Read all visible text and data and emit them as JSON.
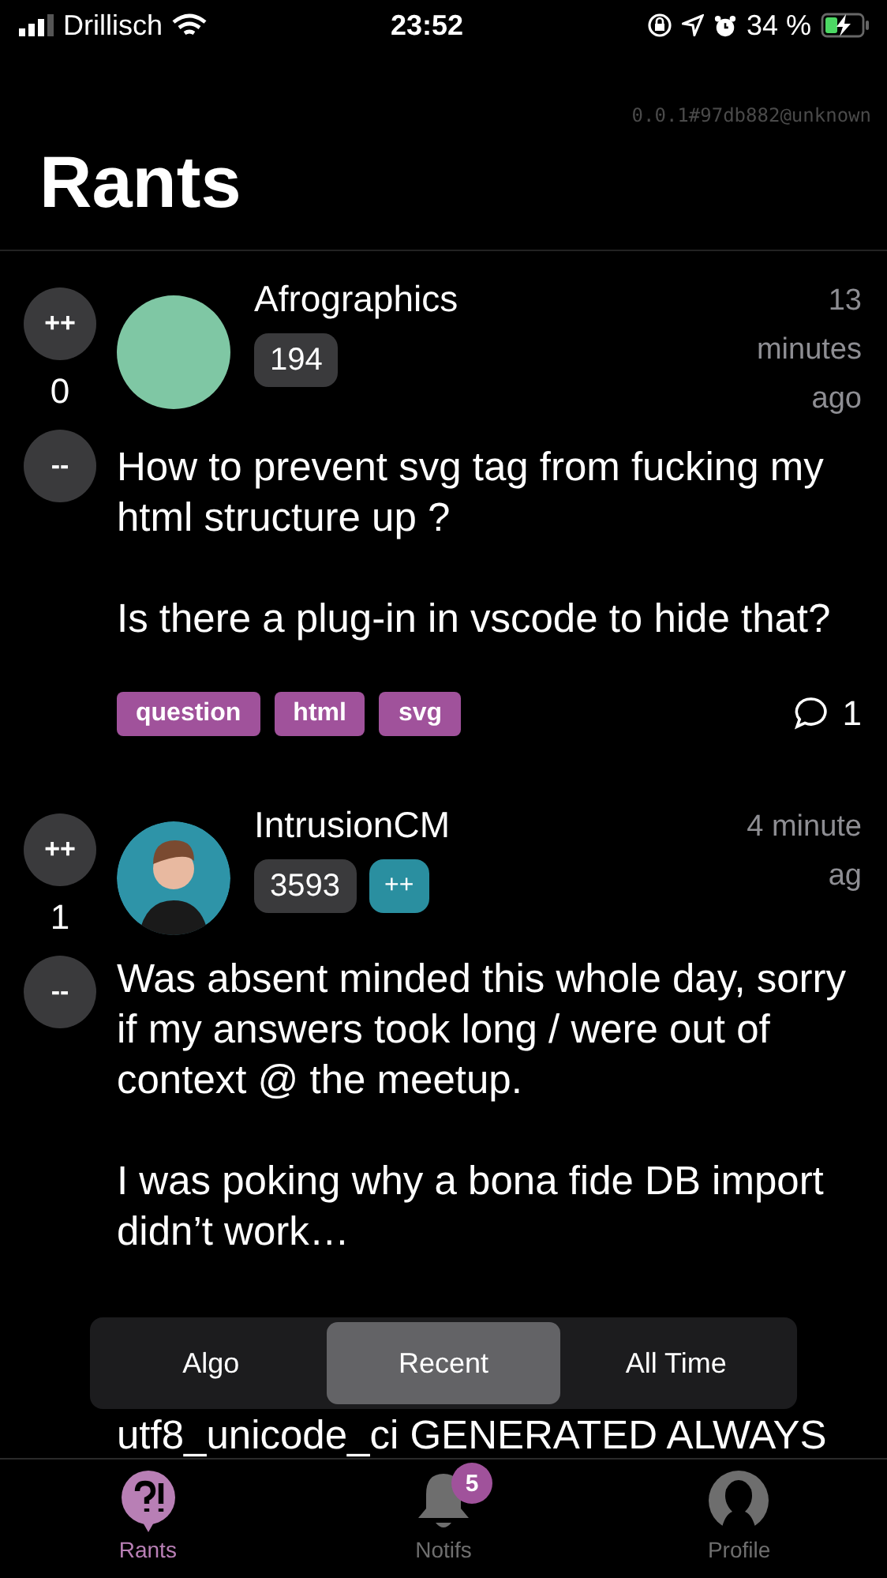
{
  "status_bar": {
    "carrier": "Drillisch",
    "time": "23:52",
    "battery": "34 %"
  },
  "version": "0.0.1#97db882@unknown",
  "title": "Rants",
  "posts": [
    {
      "upvote": "++",
      "score": "0",
      "downvote": "--",
      "username": "Afrographics",
      "avatar": {
        "kind": "plain",
        "color": "#7fc7a4"
      },
      "badges": [
        {
          "kind": "reputation",
          "text": "194"
        }
      ],
      "time": "13 minutes ago",
      "body": [
        "How to prevent svg tag from fucking my html structure up ?",
        "Is there a plug-in in vscode to hide that?"
      ],
      "tags": [
        "question",
        "html",
        "svg"
      ],
      "comments": "1"
    },
    {
      "upvote": "++",
      "score": "1",
      "downvote": "--",
      "username": "IntrusionCM",
      "avatar": {
        "kind": "silhouette",
        "color": "#2e94a8"
      },
      "badges": [
        {
          "kind": "reputation",
          "text": "3593"
        },
        {
          "kind": "supporter",
          "text": "++"
        }
      ],
      "time": "4 minute ag",
      "body": [
        "Was absent minded this whole day, sorry if my answers took long / were out of context @ the meetup.",
        "I was poking why a bona fide DB import didn’t work…",
        "utf8_unicode_ci GENERATED ALWAYS"
      ]
    }
  ],
  "sort_options": [
    {
      "label": "Algo",
      "selected": false
    },
    {
      "label": "Recent",
      "selected": true
    },
    {
      "label": "All Time",
      "selected": false
    }
  ],
  "tab_bar": [
    {
      "kind": "rants",
      "label": "Rants",
      "selected": true
    },
    {
      "kind": "notifs",
      "label": "Notifs",
      "selected": false,
      "badge": "5"
    },
    {
      "kind": "profile",
      "label": "Profile",
      "selected": false
    }
  ]
}
